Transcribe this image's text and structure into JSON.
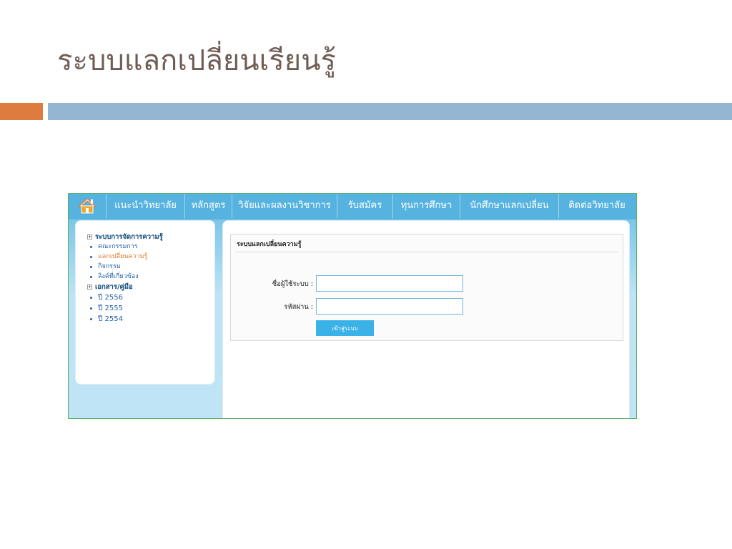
{
  "slide": {
    "title": "ระบบแลกเปลี่ยนเรียนรู้"
  },
  "colors": {
    "accent_orange": "#de7b3e",
    "accent_blue": "#94b6d2",
    "nav_blue": "#56b3df",
    "link_blue": "#1f5fa8",
    "link_active": "#e07a2e",
    "button_blue": "#3ab2e8"
  },
  "nav": {
    "home_icon": "home-icon",
    "items": [
      {
        "label": "แนะนำวิทยาลัย"
      },
      {
        "label": "หลักสูตร"
      },
      {
        "label": "วิจัยและผลงานวิชาการ"
      },
      {
        "label": "รับสมัคร"
      },
      {
        "label": "ทุนการศึกษา"
      },
      {
        "label": "นักศึกษาแลกเปลี่ยน"
      },
      {
        "label": "ติดต่อวิทยาลัย"
      }
    ]
  },
  "sidebar": {
    "section1": {
      "label": "ระบบการจัดการความรู้",
      "items": [
        {
          "label": "คณะกรรมการ"
        },
        {
          "label": "แลกเปลี่ยนความรู้"
        },
        {
          "label": "กิจกรรม"
        },
        {
          "label": "ลิงค์ที่เกี่ยวข้อง"
        }
      ]
    },
    "section2": {
      "label": "เอกสาร/คู่มือ",
      "items": [
        {
          "label": "ปี 2556"
        },
        {
          "label": "ปี 2555"
        },
        {
          "label": "ปี 2554"
        }
      ]
    }
  },
  "login": {
    "panel_title": "ระบบแลกเปลี่ยนความรู้",
    "username_label": "ชื่อผู้ใช้ระบบ :",
    "username_value": "",
    "password_label": "รหัสผ่าน :",
    "password_value": "",
    "submit_label": "เข้าสู่ระบบ"
  }
}
